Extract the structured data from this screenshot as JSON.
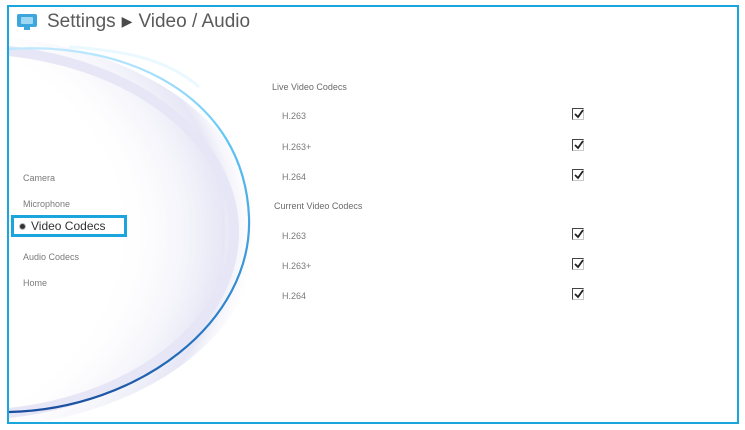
{
  "header": {
    "title": "Settings",
    "separator": "▶",
    "page": "Video / Audio",
    "icon": "monitor-icon"
  },
  "sidebar": {
    "items": [
      {
        "label": "Camera",
        "selected": false
      },
      {
        "label": "Microphone",
        "selected": false
      },
      {
        "label": "Video Codecs",
        "selected": true
      },
      {
        "label": "Audio Codecs",
        "selected": false
      },
      {
        "label": "Home",
        "selected": false
      }
    ]
  },
  "main": {
    "live": {
      "title": "Live Video Codecs",
      "codecs": [
        {
          "label": "H.263",
          "checked": true
        },
        {
          "label": "H.263+",
          "checked": true
        },
        {
          "label": "H.264",
          "checked": true
        }
      ]
    },
    "current": {
      "title": "Current Video Codecs",
      "codecs": [
        {
          "label": "H.263",
          "checked": true
        },
        {
          "label": "H.263+",
          "checked": true
        },
        {
          "label": "H.264",
          "checked": true
        }
      ]
    }
  },
  "colors": {
    "accent": "#1aa5dc",
    "text": "#7a7a7a"
  }
}
